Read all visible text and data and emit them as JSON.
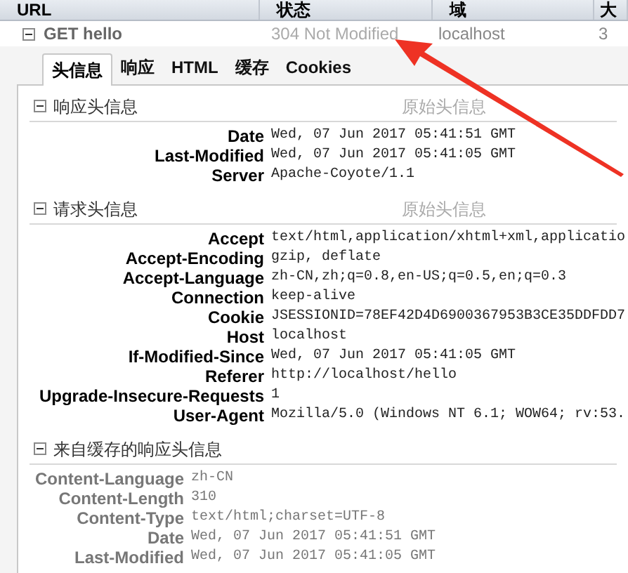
{
  "columns": [
    {
      "label": "URL"
    },
    {
      "label": "状态"
    },
    {
      "label": "域"
    },
    {
      "label": "大"
    }
  ],
  "request": {
    "expanded": true,
    "method_url": "GET hello",
    "status": "304 Not Modified",
    "domain": "localhost",
    "column_4": "3"
  },
  "tabs": [
    {
      "label": "头信息",
      "selected": true
    },
    {
      "label": "响应",
      "selected": false
    },
    {
      "label": "HTML",
      "selected": false
    },
    {
      "label": "缓存",
      "selected": false
    },
    {
      "label": "Cookies",
      "selected": false
    }
  ],
  "sections": [
    {
      "title": "响应头信息",
      "expanded": true,
      "muted": false,
      "raw_link": "原始头信息",
      "headers": [
        {
          "name": "Date",
          "value": "Wed, 07 Jun 2017 05:41:51 GMT"
        },
        {
          "name": "Last-Modified",
          "value": "Wed, 07 Jun 2017 05:41:05 GMT"
        },
        {
          "name": "Server",
          "value": "Apache-Coyote/1.1"
        }
      ]
    },
    {
      "title": "请求头信息",
      "expanded": true,
      "muted": false,
      "raw_link": "原始头信息",
      "headers": [
        {
          "name": "Accept",
          "value": "text/html,application/xhtml+xml,applicatio"
        },
        {
          "name": "Accept-Encoding",
          "value": "gzip, deflate"
        },
        {
          "name": "Accept-Language",
          "value": "zh-CN,zh;q=0.8,en-US;q=0.5,en;q=0.3"
        },
        {
          "name": "Connection",
          "value": "keep-alive"
        },
        {
          "name": "Cookie",
          "value": "JSESSIONID=78EF42D4D6900367953B3CE35DDFDD7"
        },
        {
          "name": "Host",
          "value": "localhost"
        },
        {
          "name": "If-Modified-Since",
          "value": "Wed, 07 Jun 2017 05:41:05 GMT"
        },
        {
          "name": "Referer",
          "value": "http://localhost/hello"
        },
        {
          "name": "Upgrade-Insecure-Requests",
          "value": "1"
        },
        {
          "name": "User-Agent",
          "value": "Mozilla/5.0 (Windows NT 6.1; WOW64; rv:53."
        }
      ]
    },
    {
      "title": "来自缓存的响应头信息",
      "expanded": true,
      "muted": true,
      "headers": [
        {
          "name": "Content-Language",
          "value": "zh-CN"
        },
        {
          "name": "Content-Length",
          "value": "310"
        },
        {
          "name": "Content-Type",
          "value": "text/html;charset=UTF-8"
        },
        {
          "name": "Date",
          "value": "Wed, 07 Jun 2017 05:41:51 GMT"
        },
        {
          "name": "Last-Modified",
          "value": "Wed, 07 Jun 2017 05:41:05 GMT"
        }
      ]
    }
  ]
}
